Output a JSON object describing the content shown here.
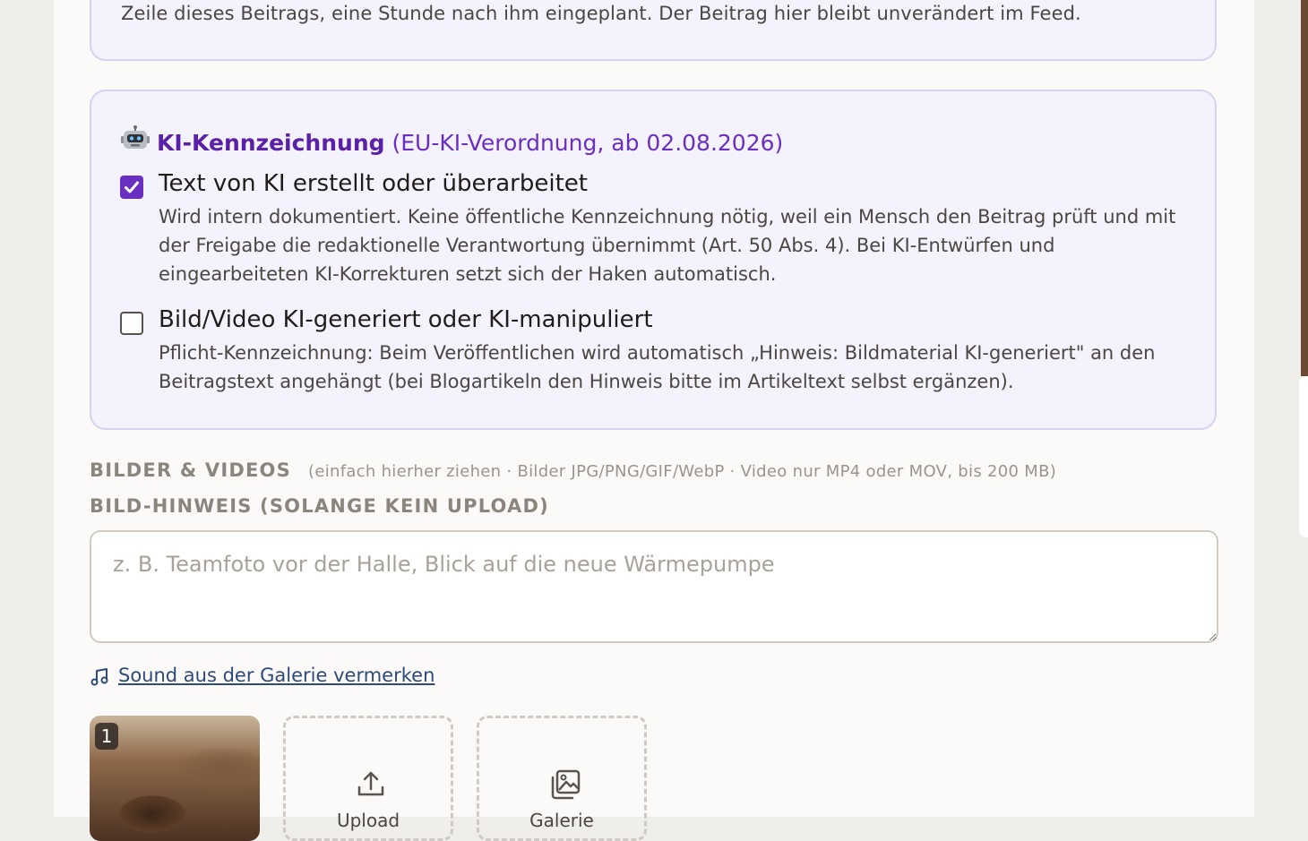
{
  "schedule_card": {
    "text": "Zeile dieses Beitrags, eine Stunde nach ihm eingeplant. Der Beitrag hier bleibt unverändert im Feed."
  },
  "ki": {
    "icon": "robot-icon",
    "title": "KI-Kennzeichnung",
    "subtitle": "(EU-KI-Verordnung, ab 02.08.2026)",
    "accent_color": "#6a2fc0",
    "options": [
      {
        "label": "Text von KI erstellt oder überarbeitet",
        "checked": true,
        "description": "Wird intern dokumentiert. Keine öffentliche Kennzeichnung nötig, weil ein Mensch den Beitrag prüft und mit der Freigabe die redaktionelle Verantwortung übernimmt (Art. 50 Abs. 4). Bei KI-Entwürfen und eingearbeiteten KI-Korrekturen setzt sich der Haken automatisch."
      },
      {
        "label": "Bild/Video KI-generiert oder KI-manipuliert",
        "checked": false,
        "description": "Pflicht-Kennzeichnung: Beim Veröffentlichen wird automatisch „Hinweis: Bildmaterial KI-generiert\" an den Beitragstext angehängt (bei Blogartikeln den Hinweis bitte im Artikeltext selbst ergänzen)."
      }
    ]
  },
  "media": {
    "heading": "BILDER & VIDEOS",
    "hint": "(einfach hierher ziehen · Bilder JPG/PNG/GIF/WebP · Video nur MP4 oder MOV, bis 200 MB)",
    "image_note_label": "BILD-HINWEIS (SOLANGE KEIN UPLOAD)",
    "image_note_placeholder": "z. B. Teamfoto vor der Halle, Blick auf die neue Wärmepumpe",
    "image_note_value": "",
    "sound_link": "Sound aus der Galerie vermerken",
    "sound_icon": "music-note-icon",
    "thumb_badge": "1",
    "upload_label": "Upload",
    "upload_icon": "upload-icon",
    "gallery_label": "Galerie",
    "gallery_icon": "gallery-icon"
  }
}
